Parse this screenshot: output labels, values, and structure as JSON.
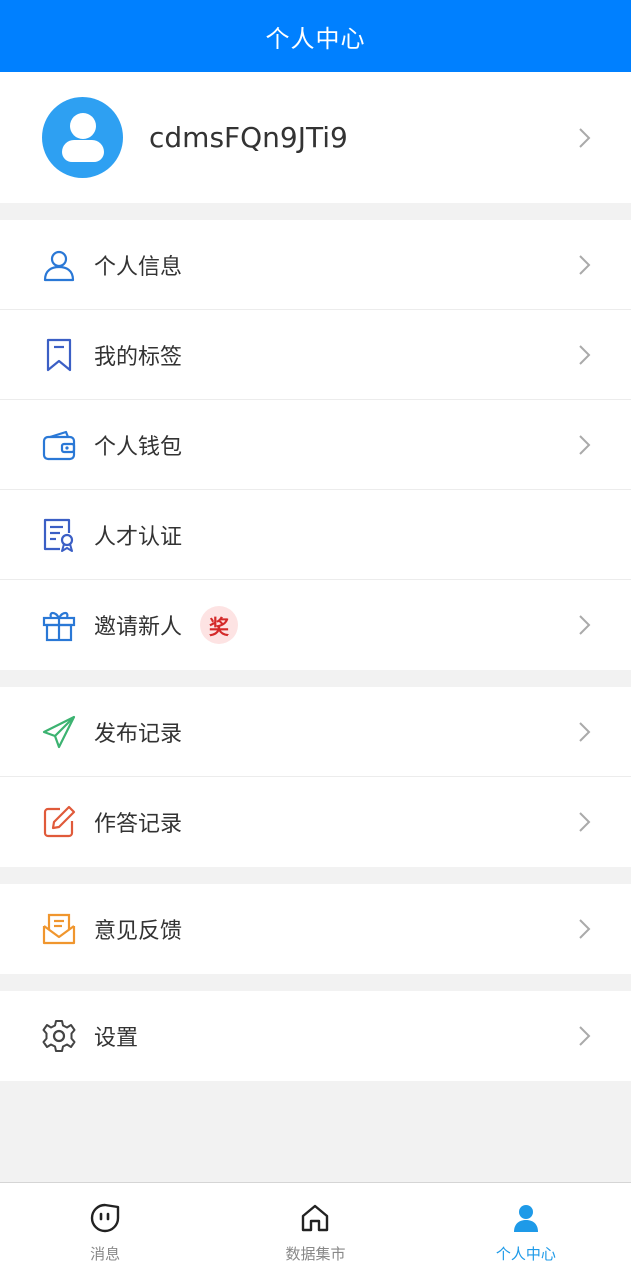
{
  "header": {
    "title": "个人中心"
  },
  "profile": {
    "username": "cdmsFQn9JTi9"
  },
  "groups": [
    {
      "items": [
        {
          "label": "个人信息",
          "icon": "person-outline-icon"
        },
        {
          "label": "我的标签",
          "icon": "bookmark-icon"
        },
        {
          "label": "个人钱包",
          "icon": "wallet-icon"
        },
        {
          "label": "人才认证",
          "icon": "certificate-icon"
        },
        {
          "label": "邀请新人",
          "icon": "gift-icon",
          "badge": "奖"
        }
      ]
    },
    {
      "items": [
        {
          "label": "发布记录",
          "icon": "paper-plane-icon"
        },
        {
          "label": "作答记录",
          "icon": "edit-icon"
        }
      ]
    },
    {
      "items": [
        {
          "label": "意见反馈",
          "icon": "mail-feedback-icon"
        }
      ]
    },
    {
      "items": [
        {
          "label": "设置",
          "icon": "gear-icon"
        }
      ]
    }
  ],
  "tabbar": {
    "tabs": [
      {
        "label": "消息",
        "icon": "message-face-icon"
      },
      {
        "label": "数据集市",
        "icon": "home-icon"
      },
      {
        "label": "个人中心",
        "icon": "person-filled-icon",
        "active": true
      }
    ]
  },
  "colors": {
    "header_bg": "#0080ff",
    "avatar_bg": "#2ea0f2",
    "active_tab": "#1e9ae8",
    "badge_text": "#d42a2a",
    "badge_bg": "#fde3e3"
  }
}
